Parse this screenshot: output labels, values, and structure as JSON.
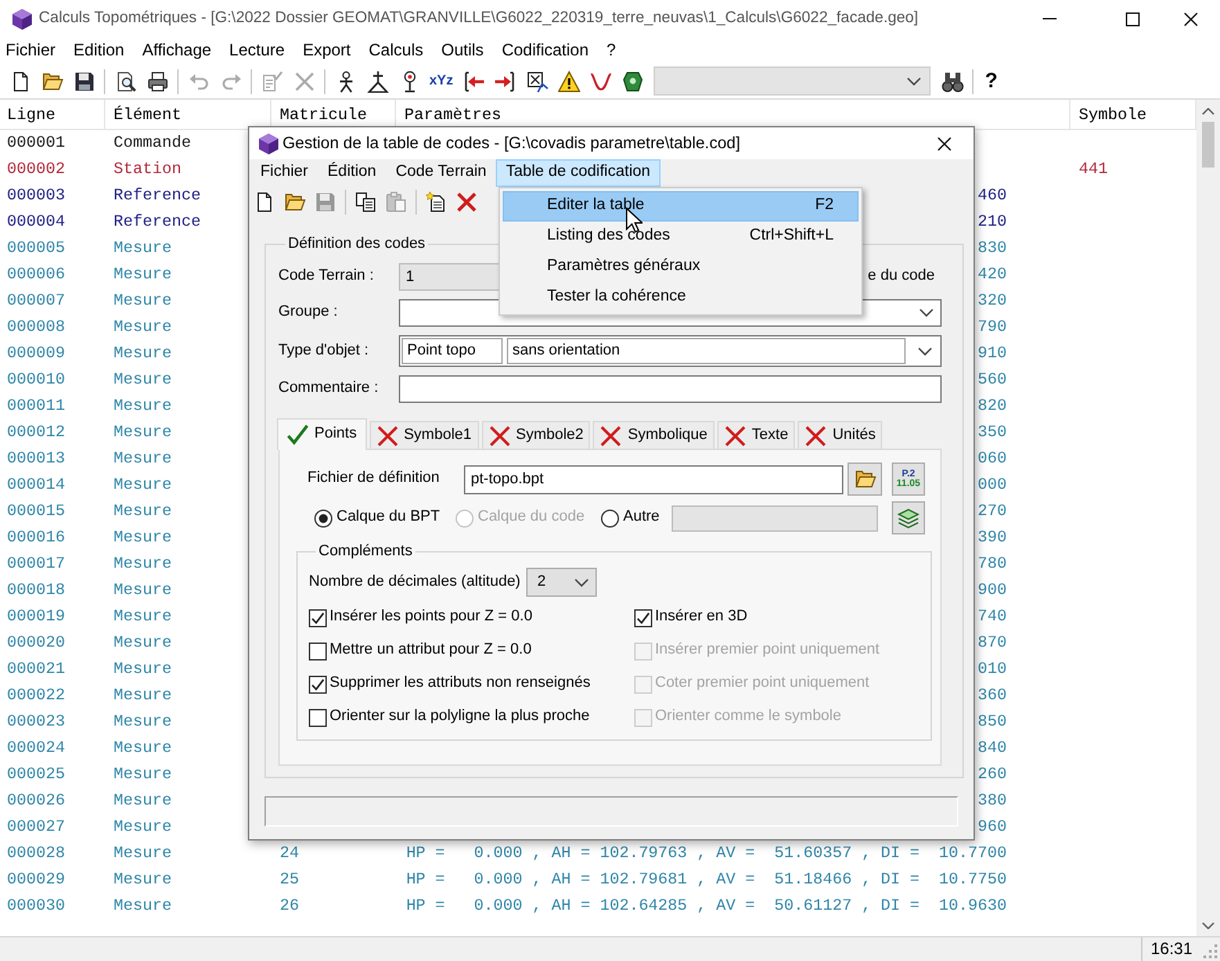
{
  "window": {
    "title": "Calculs Topométriques - [G:\\2022 Dossier GEOMAT\\GRANVILLE\\G6022_220319_terre_neuvas\\1_Calculs\\G6022_facade.geo]",
    "active": false
  },
  "menu": [
    "Fichier",
    "Edition",
    "Affichage",
    "Lecture",
    "Export",
    "Calculs",
    "Outils",
    "Codification",
    "?"
  ],
  "toolbar": [
    {
      "kind": "button",
      "disabled": false
    },
    {
      "kind": "button",
      "disabled": false
    },
    {
      "kind": "button",
      "disabled": false
    },
    {
      "kind": "separator"
    },
    {
      "kind": "button",
      "disabled": false
    },
    {
      "kind": "button",
      "disabled": false
    },
    {
      "kind": "separator"
    },
    {
      "kind": "button",
      "disabled": true
    },
    {
      "kind": "button",
      "disabled": true
    },
    {
      "kind": "separator"
    },
    {
      "kind": "button",
      "disabled": true
    },
    {
      "kind": "button",
      "disabled": true
    },
    {
      "kind": "separator"
    },
    {
      "kind": "button",
      "disabled": false
    },
    {
      "kind": "button",
      "disabled": false
    },
    {
      "kind": "button",
      "disabled": false
    },
    {
      "kind": "label_button",
      "label": "xYz",
      "disabled": false
    },
    {
      "kind": "button",
      "disabled": false
    },
    {
      "kind": "button",
      "disabled": false
    },
    {
      "kind": "button",
      "disabled": false
    },
    {
      "kind": "button",
      "disabled": false
    },
    {
      "kind": "button",
      "disabled": false
    },
    {
      "kind": "button",
      "disabled": false
    },
    {
      "kind": "combo",
      "disabled": true
    },
    {
      "kind": "button",
      "disabled": false
    },
    {
      "kind": "separator"
    },
    {
      "kind": "glyph_button",
      "label": "?",
      "disabled": false
    }
  ],
  "table": {
    "columns": [
      "Ligne",
      "Élément",
      "Matricule",
      "Paramètres",
      "Symbole"
    ],
    "rows": [
      {
        "kind": "commande",
        "ligne": "000001",
        "element": "Commande"
      },
      {
        "kind": "station",
        "ligne": "000002",
        "element": "Station",
        "symbole": "441"
      },
      {
        "kind": "reference",
        "ligne": "000003",
        "element": "Reference",
        "parametres": "460"
      },
      {
        "kind": "reference",
        "ligne": "000004",
        "element": "Reference",
        "parametres": "210"
      },
      {
        "kind": "mesure",
        "ligne": "000005",
        "element": "Mesure",
        "parametres": "830"
      },
      {
        "kind": "mesure",
        "ligne": "000006",
        "element": "Mesure",
        "parametres": "420"
      },
      {
        "kind": "mesure",
        "ligne": "000007",
        "element": "Mesure",
        "parametres": "320"
      },
      {
        "kind": "mesure",
        "ligne": "000008",
        "element": "Mesure",
        "parametres": "790"
      },
      {
        "kind": "mesure",
        "ligne": "000009",
        "element": "Mesure",
        "parametres": "910"
      },
      {
        "kind": "mesure",
        "ligne": "000010",
        "element": "Mesure",
        "parametres": "560"
      },
      {
        "kind": "mesure",
        "ligne": "000011",
        "element": "Mesure",
        "parametres": "820"
      },
      {
        "kind": "mesure",
        "ligne": "000012",
        "element": "Mesure",
        "parametres": "350"
      },
      {
        "kind": "mesure",
        "ligne": "000013",
        "element": "Mesure",
        "parametres": "060"
      },
      {
        "kind": "mesure",
        "ligne": "000014",
        "element": "Mesure",
        "parametres": "000"
      },
      {
        "kind": "mesure",
        "ligne": "000015",
        "element": "Mesure",
        "parametres": "270"
      },
      {
        "kind": "mesure",
        "ligne": "000016",
        "element": "Mesure",
        "parametres": "390"
      },
      {
        "kind": "mesure",
        "ligne": "000017",
        "element": "Mesure",
        "parametres": "780"
      },
      {
        "kind": "mesure",
        "ligne": "000018",
        "element": "Mesure",
        "parametres": "900"
      },
      {
        "kind": "mesure",
        "ligne": "000019",
        "element": "Mesure",
        "parametres": "740"
      },
      {
        "kind": "mesure",
        "ligne": "000020",
        "element": "Mesure",
        "parametres": "870"
      },
      {
        "kind": "mesure",
        "ligne": "000021",
        "element": "Mesure",
        "parametres": "010"
      },
      {
        "kind": "mesure",
        "ligne": "000022",
        "element": "Mesure",
        "parametres": "360"
      },
      {
        "kind": "mesure",
        "ligne": "000023",
        "element": "Mesure",
        "parametres": "850"
      },
      {
        "kind": "mesure",
        "ligne": "000024",
        "element": "Mesure",
        "parametres": "840"
      },
      {
        "kind": "mesure",
        "ligne": "000025",
        "element": "Mesure",
        "parametres": "260"
      },
      {
        "kind": "mesure",
        "ligne": "000026",
        "element": "Mesure",
        "parametres": "380"
      },
      {
        "kind": "mesure",
        "ligne": "000027",
        "element": "Mesure",
        "parametres": "960"
      },
      {
        "kind": "mesure",
        "ligne": "000028",
        "element": "Mesure",
        "matricule": "24",
        "parametres": "HP =   0.000 , AH = 102.79763 , AV =  51.60357 , DI =  10.7700"
      },
      {
        "kind": "mesure",
        "ligne": "000029",
        "element": "Mesure",
        "matricule": "25",
        "parametres": "HP =   0.000 , AH = 102.79681 , AV =  51.18466 , DI =  10.7750"
      },
      {
        "kind": "mesure",
        "ligne": "000030",
        "element": "Mesure",
        "matricule": "26",
        "parametres": "HP =   0.000 , AH = 102.64285 , AV =  50.61127 , DI =  10.9630"
      }
    ]
  },
  "dialog": {
    "title": "Gestion de la table de codes - [G:\\covadis parametre\\table.cod]",
    "active": true,
    "menu": [
      {
        "label": "Fichier",
        "selected": false
      },
      {
        "label": "Édition",
        "selected": false
      },
      {
        "label": "Code Terrain",
        "selected": false
      },
      {
        "label": "Table de codification",
        "selected": true
      }
    ],
    "toolbar": [
      {
        "kind": "button",
        "disabled": false
      },
      {
        "kind": "button",
        "disabled": false
      },
      {
        "kind": "button",
        "disabled": true
      },
      {
        "kind": "separator"
      },
      {
        "kind": "button",
        "disabled": false
      },
      {
        "kind": "button",
        "disabled": true
      },
      {
        "kind": "separator"
      },
      {
        "kind": "button",
        "disabled": false
      },
      {
        "kind": "button",
        "disabled": false
      }
    ],
    "dropdown": [
      {
        "label": "Editer la table",
        "shortcut": "F2",
        "selected": true
      },
      {
        "label": "Listing des codes",
        "shortcut": "Ctrl+Shift+L",
        "selected": false
      },
      {
        "label": "Paramètres généraux",
        "selected": false
      },
      {
        "label": "Tester la cohérence",
        "selected": false
      }
    ],
    "definition": {
      "title": "Définition des codes",
      "fields": [
        {
          "kind": "text",
          "label": "Code Terrain :",
          "value": "1",
          "disabled": true,
          "aside": "e du code"
        },
        {
          "kind": "select",
          "label": "Groupe :"
        },
        {
          "kind": "double_select",
          "label": "Type d'objet :",
          "values": [
            "Point topo",
            "sans orientation"
          ]
        },
        {
          "kind": "text",
          "label": "Commentaire :",
          "disabled": false
        }
      ]
    },
    "tabs": [
      {
        "label": "Points",
        "selected": true,
        "valid": true
      },
      {
        "label": "Symbole1",
        "selected": false,
        "valid": false
      },
      {
        "label": "Symbole2",
        "selected": false,
        "valid": false
      },
      {
        "label": "Symbolique",
        "selected": false,
        "valid": false
      },
      {
        "label": "Texte",
        "selected": false,
        "valid": false
      },
      {
        "label": "Unités",
        "selected": false,
        "valid": false
      }
    ],
    "points": {
      "file": {
        "label": "Fichier de définition",
        "value": "pt-topo.bpt"
      },
      "format_button": [
        "P.2",
        "11.05"
      ],
      "layers": [
        {
          "label": "Calque du BPT",
          "selected": true,
          "disabled": false
        },
        {
          "label": "Calque du code",
          "selected": false,
          "disabled": true
        },
        {
          "label": "Autre",
          "selected": false,
          "disabled": false
        }
      ],
      "other_layer_field": {
        "disabled": true
      },
      "complements": {
        "title": "Compléments",
        "decimals": {
          "label": "Nombre de décimales (altitude)",
          "value": "2"
        },
        "options": [
          {
            "label": "Insérer les points pour Z = 0.0",
            "checked": true,
            "disabled": false
          },
          {
            "label": "Insérer en 3D",
            "checked": true,
            "disabled": false
          },
          {
            "label": "Mettre un attribut pour Z = 0.0",
            "checked": false,
            "disabled": false
          },
          {
            "label": "Insérer premier point uniquement",
            "checked": false,
            "disabled": true
          },
          {
            "label": "Supprimer les attributs non renseignés",
            "checked": true,
            "disabled": false
          },
          {
            "label": "Coter premier point uniquement",
            "checked": false,
            "disabled": true
          },
          {
            "label": "Orienter sur la polyligne la plus proche",
            "checked": false,
            "disabled": false
          },
          {
            "label": "Orienter comme le symbole",
            "checked": false,
            "disabled": true
          }
        ]
      }
    }
  },
  "status_bar": {
    "time": "16:31"
  }
}
